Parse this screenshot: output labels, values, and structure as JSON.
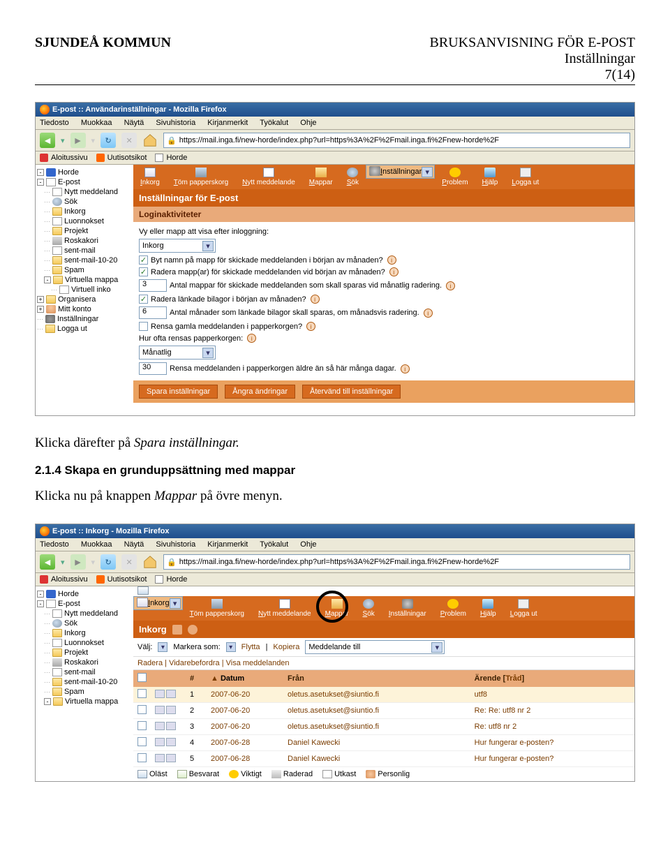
{
  "doc": {
    "header_left": "SJUNDEÅ KOMMUN",
    "header_title": "BRUKSANVISNING FÖR E-POST",
    "header_sub": "Inställningar",
    "header_page": "7(14)"
  },
  "body": {
    "p1_pre": "Klicka därefter på ",
    "p1_em": "Spara inställningar.",
    "h4": "2.1.4 Skapa en grunduppsättning med mappar",
    "p2_pre": "Klicka nu på knappen ",
    "p2_em": "Mappar",
    "p2_post": " på övre menyn."
  },
  "ss1": {
    "window_title": "E-post :: Användarinställningar - Mozilla Firefox",
    "menubar": [
      "Tiedosto",
      "Muokkaa",
      "Näytä",
      "Sivuhistoria",
      "Kirjanmerkit",
      "Työkalut",
      "Ohje"
    ],
    "url": "https://mail.inga.fi/new-horde/index.php?url=https%3A%2F%2Fmail.inga.fi%2Fnew-horde%2F",
    "bookmarks": [
      "Aloitussivu",
      "Uutisotsikot",
      "Horde"
    ],
    "topnav": {
      "items": [
        "Inkorg",
        "Töm papperskorg",
        "Nytt meddelande",
        "Mappar",
        "Sök",
        "Inställningar",
        "Problem",
        "Hjälp",
        "Logga ut"
      ],
      "selected_index": 5
    },
    "sidebar": [
      {
        "label": "Horde",
        "icon": "horde",
        "exp": "-"
      },
      {
        "label": "E-post",
        "icon": "env",
        "exp": "-",
        "indent": 0
      },
      {
        "label": "Nytt meddeland",
        "icon": "env",
        "indent": 1
      },
      {
        "label": "Sök",
        "icon": "mag",
        "indent": 1
      },
      {
        "label": "Inkorg",
        "icon": "folder",
        "indent": 1
      },
      {
        "label": "Luonnokset",
        "icon": "env",
        "indent": 1
      },
      {
        "label": "Projekt",
        "icon": "folder",
        "indent": 1
      },
      {
        "label": "Roskakori",
        "icon": "trash",
        "indent": 1
      },
      {
        "label": "sent-mail",
        "icon": "env",
        "indent": 1
      },
      {
        "label": "sent-mail-10-20",
        "icon": "folder",
        "indent": 1
      },
      {
        "label": "Spam",
        "icon": "folder",
        "indent": 1
      },
      {
        "label": "Virtuella mappa",
        "icon": "folder",
        "exp": "-",
        "indent": 1
      },
      {
        "label": "Virtuell inko",
        "icon": "env",
        "indent": 2
      },
      {
        "label": "Organisera",
        "icon": "folder",
        "exp": "+",
        "indent": 0
      },
      {
        "label": "Mitt konto",
        "icon": "user",
        "exp": "+",
        "indent": 0
      },
      {
        "label": "Inställningar",
        "icon": "gear",
        "indent": 0
      },
      {
        "label": "Logga ut",
        "icon": "folder",
        "indent": 0
      }
    ],
    "section_title": "Inställningar för E-post",
    "login_title": "Loginaktiviteter",
    "form": {
      "view_label": "Vy eller mapp att visa efter inloggning:",
      "view_value": "Inkorg",
      "chk1": "Byt namn på mapp för skickade meddelanden i början av månaden?",
      "chk2": "Radera mapp(ar) för skickade meddelanden vid början av månaden?",
      "num1_value": "3",
      "num1_label": "Antal mappar för skickade meddelanden som skall sparas vid månatlig radering.",
      "chk3": "Radera länkade bilagor i början av månaden?",
      "num2_value": "6",
      "num2_label": "Antal månader som länkade bilagor skall sparas, om månadsvis radering.",
      "chk4": "Rensa gamla meddelanden i papperkorgen?",
      "freq_label": "Hur ofta rensas papperkorgen:",
      "freq_value": "Månatlig",
      "num3_value": "30",
      "num3_label": "Rensa meddelanden i papperkorgen äldre än så här många dagar."
    },
    "buttons": [
      "Spara inställningar",
      "Ångra ändringar",
      "Återvänd till inställningar"
    ]
  },
  "ss2": {
    "window_title": "E-post :: Inkorg - Mozilla Firefox",
    "menubar": [
      "Tiedosto",
      "Muokkaa",
      "Näytä",
      "Sivuhistoria",
      "Kirjanmerkit",
      "Työkalut",
      "Ohje"
    ],
    "url": "https://mail.inga.fi/new-horde/index.php?url=https%3A%2F%2Fmail.inga.fi%2Fnew-horde%2F",
    "bookmarks": [
      "Aloitussivu",
      "Uutisotsikot",
      "Horde"
    ],
    "topnav": {
      "items": [
        "Inkorg",
        "Töm papperskorg",
        "Nytt meddelan",
        "e",
        "Mappar",
        "ök",
        "Inställningar",
        "Problem",
        "Hjälp",
        "Logga ut"
      ],
      "selected_index": 0
    },
    "sidebar": [
      {
        "label": "Horde",
        "icon": "horde",
        "exp": "-"
      },
      {
        "label": "E-post",
        "icon": "env",
        "exp": "-",
        "indent": 0
      },
      {
        "label": "Nytt meddeland",
        "icon": "env",
        "indent": 1
      },
      {
        "label": "Sök",
        "icon": "mag",
        "indent": 1
      },
      {
        "label": "Inkorg",
        "icon": "folder",
        "indent": 1
      },
      {
        "label": "Luonnokset",
        "icon": "env",
        "indent": 1
      },
      {
        "label": "Projekt",
        "icon": "folder",
        "indent": 1
      },
      {
        "label": "Roskakori",
        "icon": "trash",
        "indent": 1
      },
      {
        "label": "sent-mail",
        "icon": "env",
        "indent": 1
      },
      {
        "label": "sent-mail-10-20",
        "icon": "folder",
        "indent": 1
      },
      {
        "label": "Spam",
        "icon": "folder",
        "indent": 1
      },
      {
        "label": "Virtuella mappa",
        "icon": "folder",
        "exp": "-",
        "indent": 1
      }
    ],
    "inkorg_title": "Inkorg",
    "filter": {
      "valj": "Välj:",
      "markera": "Markera som:",
      "flytta": "Flytta",
      "kopiera": "Kopiera",
      "dest": "Meddelande till"
    },
    "actions": [
      "Radera",
      "Vidarebefordra",
      "Visa meddelanden"
    ],
    "table": {
      "headers": {
        "num": "#",
        "datum": "Datum",
        "fran": "Från",
        "arende": "Ärende",
        "trad": "Tråd"
      },
      "rows": [
        {
          "n": "1",
          "date": "2007-06-20",
          "from": "oletus.asetukset@siuntio.fi",
          "subj": "utf8"
        },
        {
          "n": "2",
          "date": "2007-06-20",
          "from": "oletus.asetukset@siuntio.fi",
          "subj": "Re: Re: utf8 nr 2"
        },
        {
          "n": "3",
          "date": "2007-06-20",
          "from": "oletus.asetukset@siuntio.fi",
          "subj": "Re: utf8 nr 2"
        },
        {
          "n": "4",
          "date": "2007-06-28",
          "from": "Daniel Kawecki",
          "subj": "Hur fungerar e-posten?"
        },
        {
          "n": "5",
          "date": "2007-06-28",
          "from": "Daniel Kawecki",
          "subj": "Hur fungerar e-posten?"
        }
      ]
    },
    "statuses": [
      "Oläst",
      "Besvarat",
      "Viktigt",
      "Raderad",
      "Utkast",
      "Personlig"
    ]
  }
}
